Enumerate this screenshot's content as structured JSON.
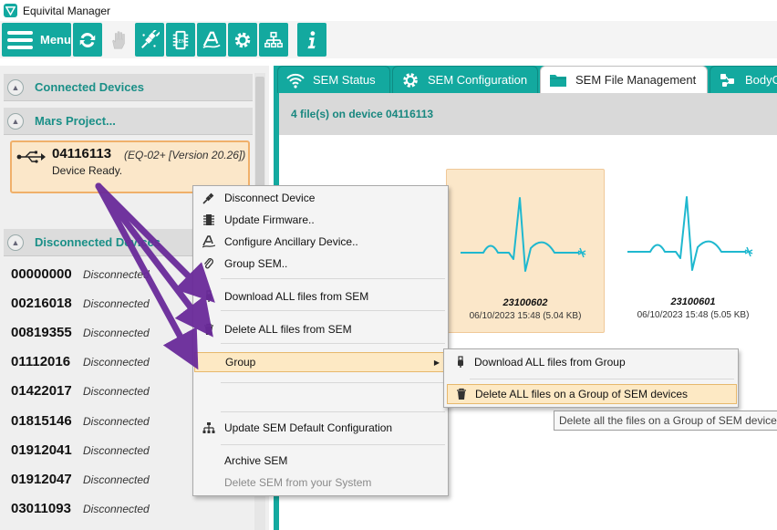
{
  "window": {
    "title": "Equivital Manager"
  },
  "toolbar": {
    "menu_label": "Menu",
    "buttons": [
      {
        "icon": "sync-icon"
      },
      {
        "icon": "hand-icon",
        "disabled": true
      },
      {
        "icon": "disconnect-plug-icon"
      },
      {
        "icon": "firmware-chip-icon"
      },
      {
        "icon": "ancillary-device-icon"
      },
      {
        "icon": "gear-icon"
      },
      {
        "icon": "network-config-icon"
      },
      {
        "icon": "info-icon"
      }
    ]
  },
  "sidebar": {
    "groups": {
      "connected": "Connected Devices",
      "project": "Mars Project...",
      "disconnected": "Disconnected Devices"
    },
    "selected_device": {
      "serial": "04116113",
      "version": "(EQ-02+ [Version 20.26])",
      "status": "Device Ready."
    },
    "disconnected_devices": [
      {
        "id": "00000000",
        "status": "Disconnected"
      },
      {
        "id": "00216018",
        "status": "Disconnected"
      },
      {
        "id": "00819355",
        "status": "Disconnected"
      },
      {
        "id": "01112016",
        "status": "Disconnected"
      },
      {
        "id": "01422017",
        "status": "Disconnected"
      },
      {
        "id": "01815146",
        "status": "Disconnected"
      },
      {
        "id": "01912041",
        "status": "Disconnected"
      },
      {
        "id": "01912047",
        "status": "Disconnected"
      },
      {
        "id": "03011093",
        "status": "Disconnected"
      }
    ]
  },
  "tabs": [
    {
      "label": "SEM Status",
      "icon": "wifi-signal-icon"
    },
    {
      "label": "SEM Configuration",
      "icon": "gear-icon"
    },
    {
      "label": "SEM File Management",
      "icon": "folder-icon",
      "active": true
    },
    {
      "label": "BodyCa",
      "icon": "body-sensor-icon"
    }
  ],
  "file_panel": {
    "summary": "4 file(s) on device 04116113",
    "files": [
      {
        "name": "23100602",
        "meta": "06/10/2023 15:48 (5.04 KB)",
        "selected": true
      },
      {
        "name": "23100601",
        "meta": "06/10/2023 15:48 (5.05 KB)",
        "selected": false
      }
    ]
  },
  "context_menu": {
    "items": [
      {
        "label": "Disconnect Device",
        "icon": "disconnect-plug-icon"
      },
      {
        "label": "Update Firmware..",
        "icon": "firmware-chip-icon"
      },
      {
        "label": "Configure Ancillary Device..",
        "icon": "ancillary-device-icon"
      },
      {
        "label": "Group SEM..",
        "icon": "paperclip-icon"
      },
      {
        "label": "Download ALL files from SEM",
        "icon": "usb-download-icon"
      },
      {
        "label": "Delete ALL files from SEM",
        "icon": "trash-icon"
      },
      {
        "label": "Group",
        "icon": "",
        "has_submenu": true,
        "highlighted": true
      },
      {
        "label": "Update SEM Default Configuration",
        "icon": "network-config-icon"
      },
      {
        "label": "Archive SEM",
        "icon": ""
      },
      {
        "label": "Delete SEM from your System",
        "icon": "",
        "disabled": true
      }
    ]
  },
  "submenu": {
    "items": [
      {
        "label": "Download ALL files from Group",
        "icon": "usb-download-icon"
      },
      {
        "label": "Delete ALL files on a Group of SEM devices",
        "icon": "trash-icon",
        "highlighted": true
      }
    ]
  },
  "tooltip": {
    "text": "Delete all the files on a Group of SEM devices"
  },
  "colors": {
    "accent": "#13a99f",
    "selection_bg": "#fbe7c9",
    "selection_border": "#f0b06a",
    "annotation_arrow": "#6a2a9a",
    "ecg_line": "#1fb8cf"
  }
}
